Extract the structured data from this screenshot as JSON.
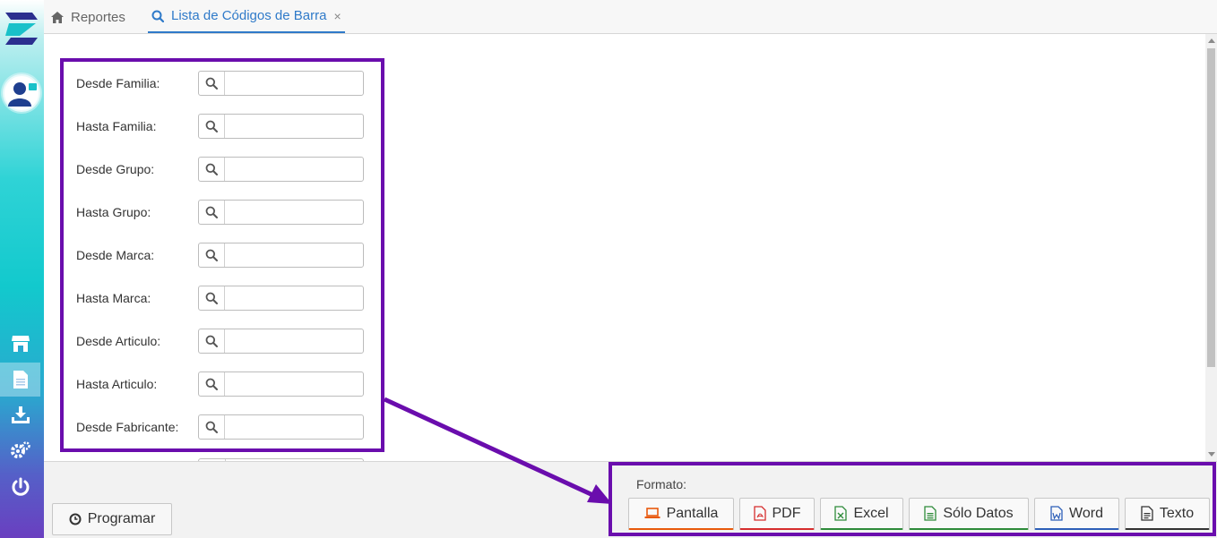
{
  "tabs": [
    {
      "label": "Reportes",
      "icon": "home-icon"
    },
    {
      "label": "Lista de Códigos de Barra",
      "icon": "search-icon",
      "close": "×"
    }
  ],
  "filters": [
    {
      "label": "Desde Familia:",
      "value": ""
    },
    {
      "label": "Hasta Familia:",
      "value": ""
    },
    {
      "label": "Desde Grupo:",
      "value": ""
    },
    {
      "label": "Hasta Grupo:",
      "value": ""
    },
    {
      "label": "Desde Marca:",
      "value": ""
    },
    {
      "label": "Hasta Marca:",
      "value": ""
    },
    {
      "label": "Desde Articulo:",
      "value": ""
    },
    {
      "label": "Hasta Articulo:",
      "value": ""
    },
    {
      "label": "Desde Fabricante:",
      "value": ""
    }
  ],
  "bottom": {
    "programar_label": "Programar",
    "formato_label": "Formato:",
    "formats": [
      {
        "label": "Pantalla",
        "icon": "laptop-icon",
        "color": "#e8590c"
      },
      {
        "label": "PDF",
        "icon": "pdf-file-icon",
        "color": "#d62d2d"
      },
      {
        "label": "Excel",
        "icon": "excel-file-icon",
        "color": "#2e8b3a"
      },
      {
        "label": "Sólo Datos",
        "icon": "data-file-icon",
        "color": "#2e8b3a"
      },
      {
        "label": "Word",
        "icon": "word-file-icon",
        "color": "#2d5fb8"
      },
      {
        "label": "Texto",
        "icon": "text-file-icon",
        "color": "#333333"
      }
    ]
  },
  "colors": {
    "accent": "#2f7ac9",
    "annotation": "#6a0dad"
  }
}
